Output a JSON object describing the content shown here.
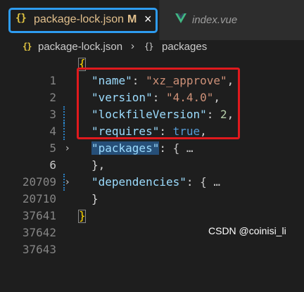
{
  "tabs": [
    {
      "label": "package-lock.json",
      "badge": "M",
      "close": "×",
      "icon": "json-braces-icon",
      "active": true
    },
    {
      "label": "index.vue",
      "icon": "vue-icon",
      "active": false
    }
  ],
  "breadcrumb": {
    "file": "package-lock.json",
    "separator": "›",
    "node": "packages",
    "file_icon": "{}",
    "node_icon": "{}"
  },
  "editor": {
    "lines": [
      {
        "number": "1",
        "text": "{"
      },
      {
        "number": "2",
        "key": "\"name\"",
        "value": "\"xz_approve\"",
        "trail": ","
      },
      {
        "number": "3",
        "key": "\"version\"",
        "value": "\"4.4.0\"",
        "trail": ","
      },
      {
        "number": "4",
        "key": "\"lockfileVersion\"",
        "value": "2",
        "trail": ","
      },
      {
        "number": "5",
        "key": "\"requires\"",
        "value": "true",
        "trail": ","
      },
      {
        "number": "6",
        "key": "\"packages\"",
        "value": "{ …",
        "folded": true
      },
      {
        "number": "20709",
        "text": "},"
      },
      {
        "number": "20710",
        "key": "\"dependencies\"",
        "value": "{ …",
        "folded": true
      },
      {
        "number": "37641",
        "text": "}"
      },
      {
        "number": "37642",
        "text": "}"
      },
      {
        "number": "37643",
        "text": ""
      }
    ],
    "current_line": "6"
  },
  "colors": {
    "accent_frame": "#2e9cf0",
    "annotation_box": "#e0191d",
    "key": "#9cdcfe",
    "string": "#ce9178",
    "number": "#b5cea8",
    "keyword": "#569cd6"
  },
  "watermark": "CSDN @coinisi_li"
}
